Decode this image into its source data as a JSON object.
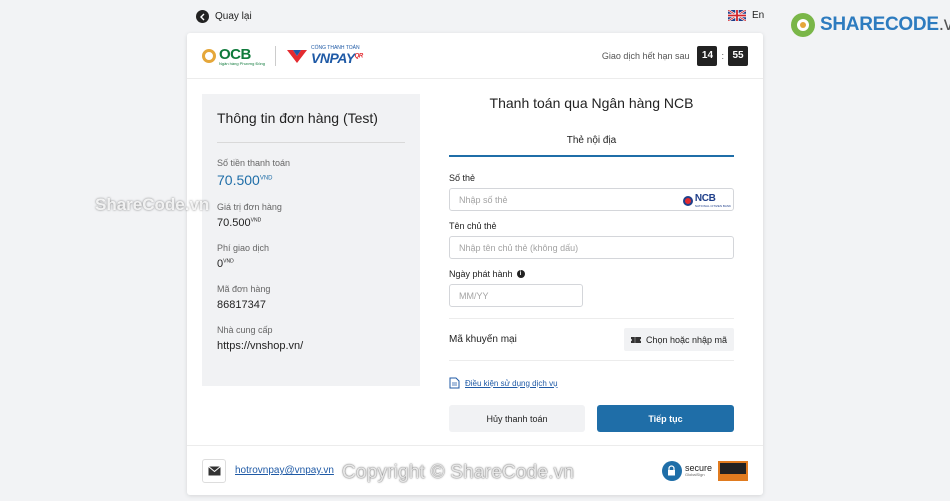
{
  "topbar": {
    "back_label": "Quay lại",
    "lang_label": "En"
  },
  "watermark": {
    "brand": "SHARECODE",
    "brand_suffix": ".vn",
    "center": "Copyright © ShareCode.vn",
    "mid": "ShareCode.vn"
  },
  "header": {
    "ocb_name": "OCB",
    "ocb_tagline": "Ngân hàng Phương Đông",
    "vnpay_caption": "CỔNG THANH TOÁN",
    "vnpay_name": "VNPAY",
    "vnpay_qr": "QR",
    "timer_label": "Giao dịch hết hạn sau",
    "timer_min": "14",
    "timer_sep": ":",
    "timer_sec": "55"
  },
  "order": {
    "title": "Thông tin đơn hàng (Test)",
    "amount_label": "Số tiền thanh toán",
    "amount_value": "70.500",
    "currency": "VND",
    "order_value_label": "Giá trị đơn hàng",
    "order_value": "70.500",
    "fee_label": "Phí giao dịch",
    "fee_value": "0",
    "order_id_label": "Mã đơn hàng",
    "order_id": "86817347",
    "provider_label": "Nhà cung cấp",
    "provider": "https://vnshop.vn/"
  },
  "form": {
    "title": "Thanh toán qua Ngân hàng NCB",
    "tab_label": "Thẻ nội địa",
    "card_number_label": "Số thẻ",
    "card_number_placeholder": "Nhập số thẻ",
    "bank_badge": "NCB",
    "bank_badge_sub": "NATIONAL CITIZEN BANK",
    "holder_label": "Tên chủ thẻ",
    "holder_placeholder": "Nhập tên chủ thẻ (không dấu)",
    "issue_date_label": "Ngày phát hành",
    "issue_date_placeholder": "MM/YY",
    "promo_label": "Mã khuyến mại",
    "promo_button": "Chọn hoặc nhập mã",
    "terms_link": "Điều kiện sử dụng dịch vụ",
    "cancel_button": "Hủy thanh toán",
    "continue_button": "Tiếp tục"
  },
  "footer": {
    "email": "hotrovnpay@vnpay.vn",
    "secure_label": "secure",
    "secure_sub": "GlobalSign"
  },
  "colors": {
    "primary": "#1f6ea8",
    "dark": "#222222",
    "panel": "#f1f2f4"
  }
}
